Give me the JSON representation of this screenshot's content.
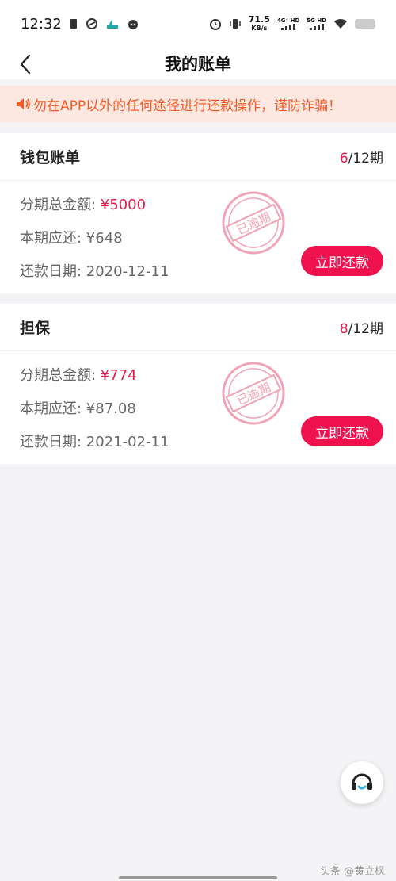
{
  "status_bar": {
    "time": "12:32",
    "net_speed_value": "71.5",
    "net_speed_unit": "KB/s",
    "signal1_label": "4G⁺ HD",
    "signal2_label": "5G HD"
  },
  "nav": {
    "title": "我的账单"
  },
  "notice": {
    "text": "勿在APP以外的任何途径进行还款操作，谨防诈骗！"
  },
  "bills": [
    {
      "title": "钱包账单",
      "period_current": "6",
      "period_total": "/12期",
      "total_label": "分期总金额: ",
      "total_value": "¥5000",
      "due_label": "本期应还: ",
      "due_value": "¥648",
      "date_label": "还款日期: ",
      "date_value": "2020-12-11",
      "stamp_text": "已逾期",
      "pay_label": "立即还款"
    },
    {
      "title": "担保",
      "period_current": "8",
      "period_total": "/12期",
      "total_label": "分期总金额: ",
      "total_value": "¥774",
      "due_label": "本期应还: ",
      "due_value": "¥87.08",
      "date_label": "还款日期: ",
      "date_value": "2021-02-11",
      "stamp_text": "已逾期",
      "pay_label": "立即还款"
    }
  ],
  "watermark": "头条 @黄立枫",
  "colors": {
    "accent": "#f0124f",
    "notice_text": "#f15a24",
    "notice_bg": "#fde7e1",
    "stamp": "#f2a2b6"
  }
}
